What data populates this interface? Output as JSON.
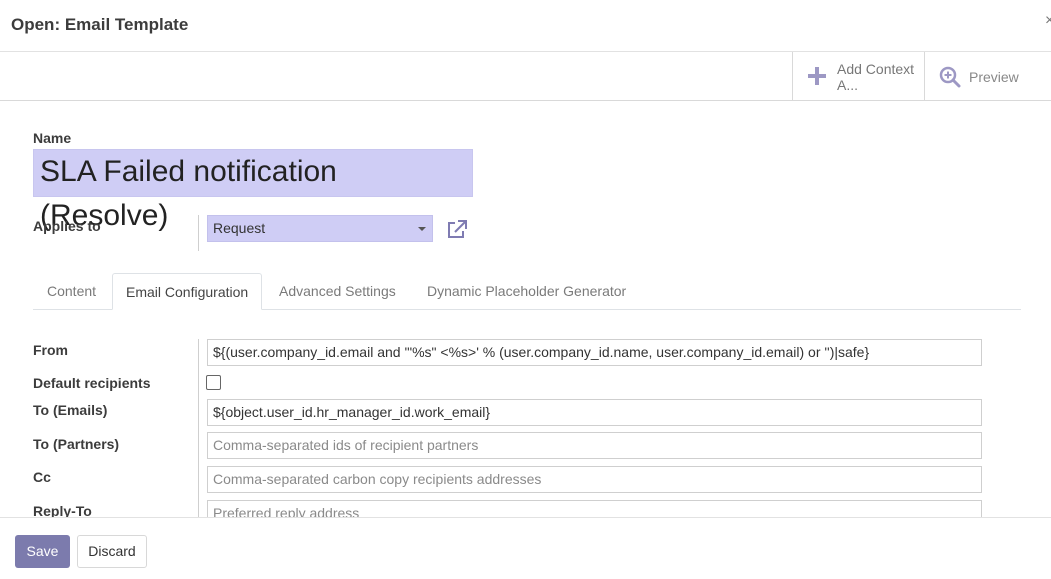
{
  "modal": {
    "title": "Open: Email Template",
    "close_glyph": "×"
  },
  "button_box": {
    "add_context_label": "Add Context A...",
    "add_context_icon": "plus-icon",
    "preview_label": "Preview",
    "preview_icon": "zoom-in-icon"
  },
  "form": {
    "name_label": "Name",
    "name_value": "SLA Failed notification (Resolve)",
    "applies_to_label": "Applies to",
    "applies_to_value": "Request"
  },
  "tabs": [
    {
      "label": "Content"
    },
    {
      "label": "Email Configuration"
    },
    {
      "label": "Advanced Settings"
    },
    {
      "label": "Dynamic Placeholder Generator"
    }
  ],
  "active_tab": "Email Configuration",
  "email_config": {
    "from_label": "From",
    "from_value": "${(user.company_id.email and '\"%s\" <%s>' % (user.company_id.name, user.company_id.email) or '')|safe}",
    "default_recipients_label": "Default recipients",
    "default_recipients_checked": false,
    "to_emails_label": "To (Emails)",
    "to_emails_value": "${object.user_id.hr_manager_id.work_email}",
    "to_partners_label": "To (Partners)",
    "to_partners_placeholder": "Comma-separated ids of recipient partners",
    "cc_label": "Cc",
    "cc_placeholder": "Comma-separated carbon copy recipients addresses",
    "reply_to_label": "Reply-To",
    "reply_to_placeholder": "Preferred reply address"
  },
  "footer": {
    "save_label": "Save",
    "discard_label": "Discard"
  },
  "colors": {
    "primary": "#7c7bad",
    "input_highlight": "#cfcdf5",
    "icon_accent": "#9d98c4"
  }
}
